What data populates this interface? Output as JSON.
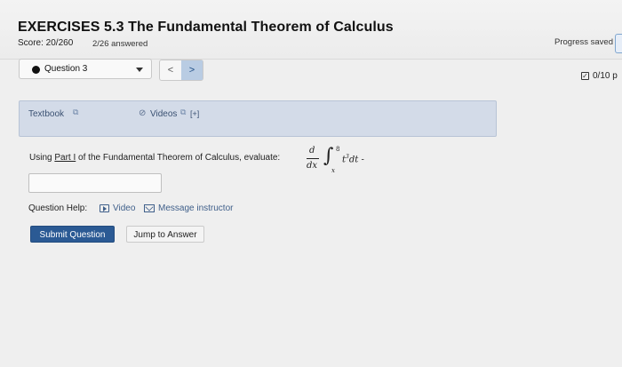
{
  "header": {
    "title": "EXERCISES 5.3 The Fundamental Theorem of Calculus",
    "score": "Score: 20/260",
    "answered": "2/26 answered",
    "progress_saved": "Progress saved"
  },
  "question_nav": {
    "selected": "Question 3",
    "prev": "<",
    "next": ">",
    "points": "0/10 p"
  },
  "resources": {
    "textbook": "Textbook",
    "videos": "Videos",
    "videos_expand": "[+]"
  },
  "question": {
    "prefix": "Using ",
    "part_link": "Part I",
    "suffix": " of the Fundamental Theorem of Calculus, evaluate:",
    "math": {
      "deriv_num": "d",
      "deriv_den": "dx",
      "integral_sign": "∫",
      "upper_limit": "8",
      "lower_limit": "x",
      "integrand_base": "t",
      "integrand_exp": "3",
      "integrand_diff": "dt",
      "trailing": "-"
    },
    "answer_value": ""
  },
  "help": {
    "label": "Question Help:",
    "video": "Video",
    "message": "Message instructor"
  },
  "actions": {
    "submit": "Submit Question",
    "jump": "Jump to Answer"
  },
  "colors": {
    "primary_button": "#2b5a94",
    "resource_panel": "#d3dbe8",
    "link": "#3f5f8a"
  }
}
